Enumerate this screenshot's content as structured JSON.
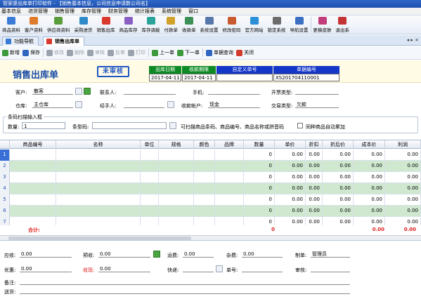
{
  "window": {
    "title": "管家婆出库单打印软件 - 【销售基本信息，公司信息申请数公司名】"
  },
  "menu": [
    "基本信息",
    "进货管理",
    "销售管理",
    "库存管理",
    "财务管理",
    "统计报表",
    "系统管理",
    "窗口"
  ],
  "toolbar": [
    {
      "label": "商品资料",
      "color": "#3a7bd5"
    },
    {
      "label": "客户资料",
      "color": "#e07b2b"
    },
    {
      "label": "供应商资料",
      "color": "#5a9e3c"
    },
    {
      "label": "采购进货",
      "color": "#2f8ac9"
    },
    {
      "label": "销售出库",
      "color": "#d9382c"
    },
    {
      "label": "商品库存",
      "color": "#8a5fc4"
    },
    {
      "label": "库存调拨",
      "color": "#2aa39a"
    },
    {
      "label": "付款单",
      "color": "#d2a12b"
    },
    {
      "label": "收款单",
      "color": "#3c8f56"
    },
    {
      "label": "系统设置",
      "color": "#5678a8"
    },
    {
      "label": "修改密码",
      "color": "#c85a2d"
    },
    {
      "label": "官方网站",
      "color": "#2b8fd8"
    },
    {
      "label": "锁定系统",
      "color": "#6c6c6c"
    },
    {
      "label": "导航设置",
      "color": "#3b6fc2"
    },
    {
      "label": "更换皮肤",
      "color": "#c13c7a"
    },
    {
      "label": "退出系",
      "color": "#c43434"
    }
  ],
  "tabs": [
    {
      "label": "功能导航",
      "active": false
    },
    {
      "label": "销售出库单",
      "active": true
    }
  ],
  "tab_nav": "◂ ▸ ×",
  "actions": [
    {
      "label": "新增",
      "color": "#3c9a3c",
      "enabled": true
    },
    {
      "label": "保存",
      "color": "#2f66c2",
      "enabled": true
    },
    {
      "label": "修改",
      "color": "#9aa3ad",
      "enabled": false
    },
    {
      "label": "删除",
      "color": "#9aa3ad",
      "enabled": false
    },
    {
      "label": "审核",
      "color": "#9aa3ad",
      "enabled": false
    },
    {
      "label": "反审",
      "color": "#9aa3ad",
      "enabled": false
    },
    {
      "label": "打印",
      "color": "#9aa3ad",
      "enabled": false
    },
    {
      "label": "上一单",
      "color": "#3c9a3c",
      "enabled": true
    },
    {
      "label": "下一单",
      "color": "#3c9a3c",
      "enabled": true
    },
    {
      "label": "单据查询",
      "color": "#2f66c2",
      "enabled": true
    },
    {
      "label": "关闭",
      "color": "#d23b2b",
      "enabled": true
    }
  ],
  "doc": {
    "title": "销售出库单",
    "stamp": "未审核",
    "labels": {
      "date": "出库日期",
      "due": "收款期限",
      "custom": "自定义单号",
      "number": "单据编号"
    },
    "values": {
      "date": "2017-04-11",
      "due": "2017-04-11",
      "custom": "",
      "number": "XS201704110001"
    }
  },
  "form": {
    "customer_label": "客户:",
    "customer": "散客",
    "contact_label": "联系人:",
    "contact": "",
    "phone_label": "手机:",
    "phone": "",
    "invoice_label": "开票类型:",
    "invoice": "",
    "warehouse_label": "仓库:",
    "warehouse": "主仓库",
    "handler_label": "经手人:",
    "handler": "",
    "account_label": "收款帐户:",
    "account": "现金",
    "trade_label": "交易类型:",
    "trade": "欠款"
  },
  "scan": {
    "legend": "条码扫描输入框",
    "qty_label": "数量:",
    "qty": "1",
    "barcode_label": "条型码:",
    "barcode": "",
    "hint": "可扫描商品条码、商品编号、商品名称或拼音码",
    "auto_add": "同种商品自动累加"
  },
  "grid": {
    "columns": [
      "",
      "商品编号",
      "名称",
      "单位",
      "规格",
      "颜色",
      "品牌",
      "数量",
      "单价",
      "折扣",
      "折后价",
      "成本价",
      "利润"
    ],
    "rows": [
      {
        "num": "1",
        "qty": "0",
        "price": "0.00",
        "discount": "0.00",
        "after": "0.00",
        "cost": "0.00",
        "profit": "0.00"
      },
      {
        "num": "2",
        "qty": "0",
        "price": "0.00",
        "discount": "0.00",
        "after": "0.00",
        "cost": "0.00",
        "profit": "0.00"
      },
      {
        "num": "3",
        "qty": "0",
        "price": "0.00",
        "discount": "0.00",
        "after": "0.00",
        "cost": "0.00",
        "profit": "0.00"
      },
      {
        "num": "4",
        "qty": "0",
        "price": "0.00",
        "discount": "0.00",
        "after": "0.00",
        "cost": "0.00",
        "profit": "0.00"
      },
      {
        "num": "5",
        "qty": "0",
        "price": "0.00",
        "discount": "0.00",
        "after": "0.00",
        "cost": "0.00",
        "profit": "0.00"
      },
      {
        "num": "6",
        "qty": "0",
        "price": "0.00",
        "discount": "0.00",
        "after": "0.00",
        "cost": "0.00",
        "profit": "0.00"
      },
      {
        "num": "7",
        "qty": "0",
        "price": "0.00",
        "discount": "0.00",
        "after": "0.00",
        "cost": "0.00",
        "profit": "0.00"
      }
    ],
    "total_label": "合计:",
    "total": {
      "qty": "0",
      "cost": "0.00",
      "profit": "0.00"
    }
  },
  "footer": {
    "due_label": "应收:",
    "due": "0.00",
    "prepaid_label": "预收:",
    "prepaid": "0.00",
    "freight_label": "运费:",
    "freight": "0.00",
    "misc_label": "杂费:",
    "misc": "0.00",
    "maker_label": "制单:",
    "maker": "管理员",
    "discount_label": "优惠:",
    "discount": "0.00",
    "received_label": "收现:",
    "received": "0.00",
    "express_label": "快递:",
    "express": "",
    "track_label": "单号:",
    "track": "",
    "auditor_label": "审核:",
    "auditor": "",
    "remark_label": "备注:",
    "remark": "",
    "shipping_label": "送货:",
    "shipping": ""
  },
  "colors": {
    "row_alt": "#cfe8cf",
    "row_sel": "#3a6fd6",
    "total_red": "#e02020"
  }
}
